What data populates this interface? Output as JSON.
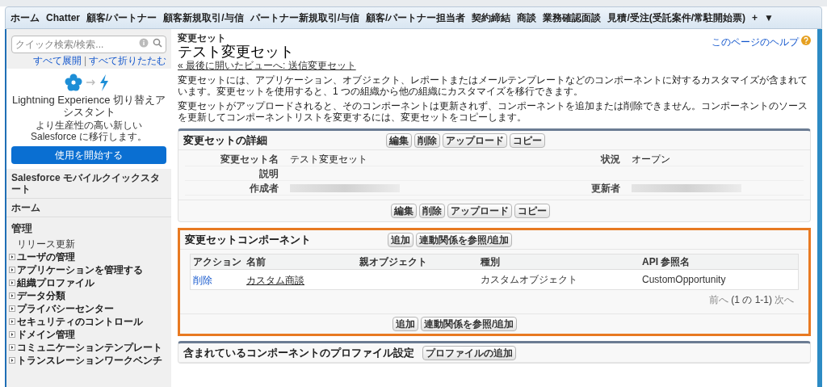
{
  "tabs": [
    {
      "label": "ホーム",
      "selected": false
    },
    {
      "label": "Chatter",
      "selected": false
    },
    {
      "label": "顧客/パートナー",
      "selected": false
    },
    {
      "label": "顧客新規取引/与信",
      "selected": false
    },
    {
      "label": "パートナー新規取引/与信",
      "selected": false
    },
    {
      "label": "顧客/パートナー担当者",
      "selected": false
    },
    {
      "label": "契約締結",
      "selected": false
    },
    {
      "label": "商談",
      "selected": false
    },
    {
      "label": "業務確認面談",
      "selected": false
    },
    {
      "label": "見積/受注(受託案件/常駐開始票)",
      "selected": false
    },
    {
      "label": "+",
      "selected": false
    },
    {
      "label": "▼",
      "selected": false
    }
  ],
  "sidebar": {
    "search": {
      "placeholder": "クイック検索/検索..."
    },
    "expand_all": "すべて展開",
    "separator": "|",
    "collapse_all": "すべて折りたたむ",
    "promo": {
      "title": "Lightning Experience 切り替えアシスタント",
      "text": "より生産性の高い新しい Salesforce に移行します。",
      "button": "使用を開始する"
    },
    "sections": [
      {
        "label": "Salesforce モバイルクイックスタート"
      },
      {
        "label": "ホーム"
      }
    ],
    "admin": {
      "label": "管理",
      "items": [
        {
          "label": "リリース更新",
          "expandable": false
        },
        {
          "label": "ユーザの管理",
          "expandable": true
        },
        {
          "label": "アプリケーションを管理する",
          "expandable": true
        },
        {
          "label": "組織プロファイル",
          "expandable": true
        },
        {
          "label": "データ分類",
          "expandable": true
        },
        {
          "label": "プライバシーセンター",
          "expandable": true
        },
        {
          "label": "セキュリティのコントロール",
          "expandable": true
        },
        {
          "label": "ドメイン管理",
          "expandable": true
        },
        {
          "label": "コミュニケーションテンプレート",
          "expandable": true
        },
        {
          "label": "トランスレーションワークベンチ",
          "expandable": true
        }
      ]
    }
  },
  "page": {
    "breadcrumb": "変更セット",
    "title": "テスト変更セット",
    "back_link": "« 最後に開いたビューへ: 送信変更セット",
    "help": "このページのヘルプ",
    "paragraphs": [
      "変更セットには、アプリケーション、オブジェクト、レポートまたはメールテンプレートなどのコンポーネントに対するカスタマイズが含まれています。変更セットを使用すると、1 つの組織から他の組織にカスタマイズを移行できます。",
      "変更セットがアップロードされると、そのコンポーネントは更新されず、コンポーネントを追加または削除できません。コンポーネントのソースを更新してコンポーネントリストを変更するには、変更セットをコピーします。"
    ]
  },
  "details": {
    "title": "変更セットの詳細",
    "buttons": [
      "編集",
      "削除",
      "アップロード",
      "コピー"
    ],
    "fields": [
      [
        {
          "label": "変更セット名",
          "value": "テスト変更セット"
        },
        {
          "label": "状況",
          "value": "オープン"
        }
      ],
      [
        {
          "label": "説明"
        }
      ],
      [
        {
          "label": "作成者",
          "redacted": true
        },
        {
          "label": "更新者",
          "redacted": true
        }
      ]
    ],
    "bottom_buttons": [
      "編集",
      "削除",
      "アップロード",
      "コピー"
    ]
  },
  "components": {
    "title": "変更セットコンポーネント",
    "highlighted": true,
    "buttons": [
      "追加",
      "連動関係を参照/追加"
    ],
    "columns": [
      "アクション",
      "名前",
      "親オブジェクト",
      "種別",
      "API 参照名"
    ],
    "rows": [
      {
        "action": "削除",
        "name": "カスタム商談",
        "type": "カスタムオブジェクト",
        "api_name": "CustomOpportunity"
      }
    ],
    "pager": {
      "prev": "前へ",
      "range": "(1 の 1-1)",
      "next": "次へ"
    },
    "bottom_buttons": [
      "追加",
      "連動関係を参照/追加"
    ]
  },
  "profiles": {
    "title": "含まれているコンポーネントのプロファイル設定",
    "buttons": [
      "プロファイルの追加"
    ]
  }
}
